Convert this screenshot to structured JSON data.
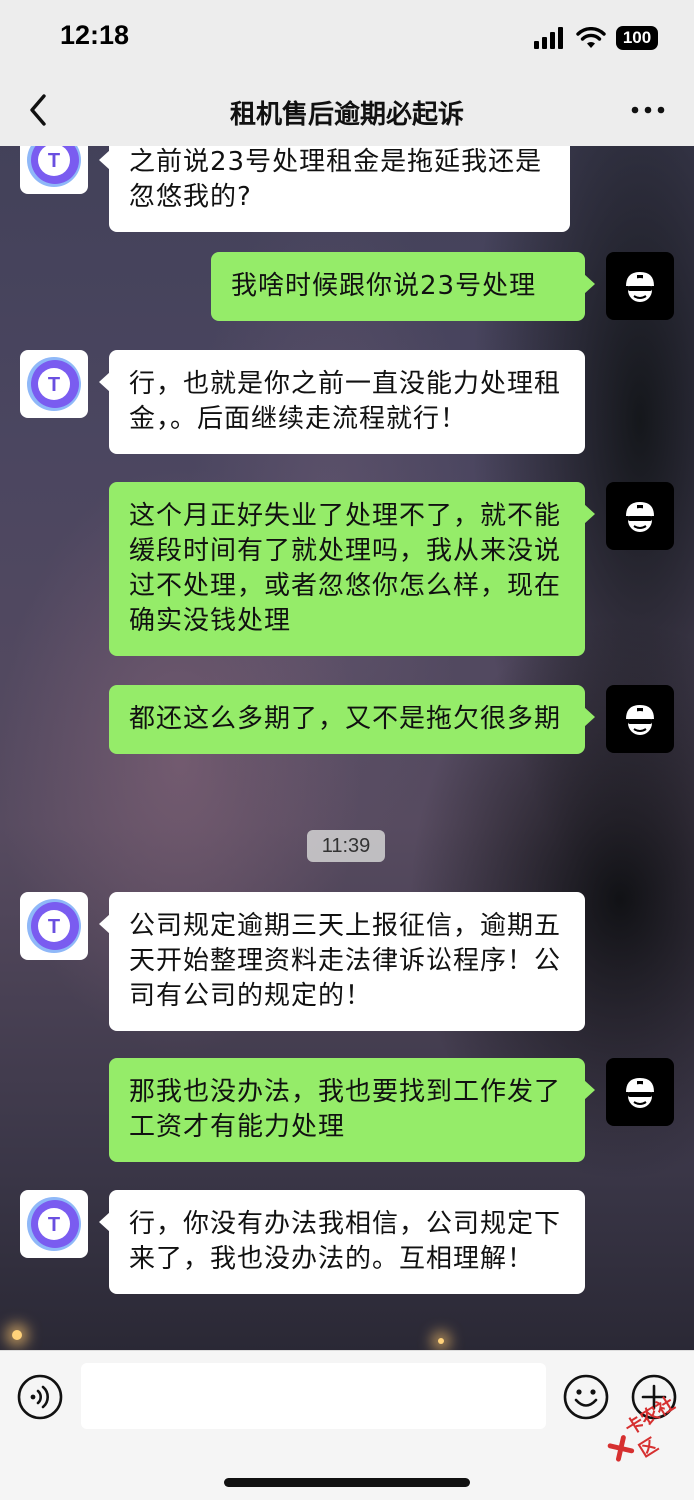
{
  "status_bar": {
    "time": "12:18",
    "battery": "100"
  },
  "nav": {
    "title": "租机售后逾期必起诉"
  },
  "messages": [
    {
      "from": "company",
      "text": "之前说23号处理租金是拖延我还是忽悠我的?"
    },
    {
      "from": "me",
      "text": "我啥时候跟你说23号处理"
    },
    {
      "from": "company",
      "text": "行，也就是你之前一直没能力处理租金，。后面继续走流程就行！"
    },
    {
      "from": "me",
      "text": "这个月正好失业了处理不了，就不能缓段时间有了就处理吗，我从来没说过不处理，或者忽悠你怎么样，现在确实没钱处理"
    },
    {
      "from": "me",
      "text": "都还这么多期了，又不是拖欠很多期"
    },
    {
      "from": "company",
      "text": "公司规定逾期三天上报征信，逾期五天开始整理资料走法律诉讼程序！公司有公司的规定的！"
    },
    {
      "from": "me",
      "text": "那我也没办法，我也要找到工作发了工资才有能力处理"
    },
    {
      "from": "company",
      "text": "行，你没有办法我相信，公司规定下来了，我也没办法的。互相理解！"
    }
  ],
  "timestamp": "11:39",
  "watermark": "卡农社区",
  "colors": {
    "bubble_green": "#95ec69",
    "bubble_white": "#ffffff",
    "company_logo": "#6a5cf0"
  }
}
